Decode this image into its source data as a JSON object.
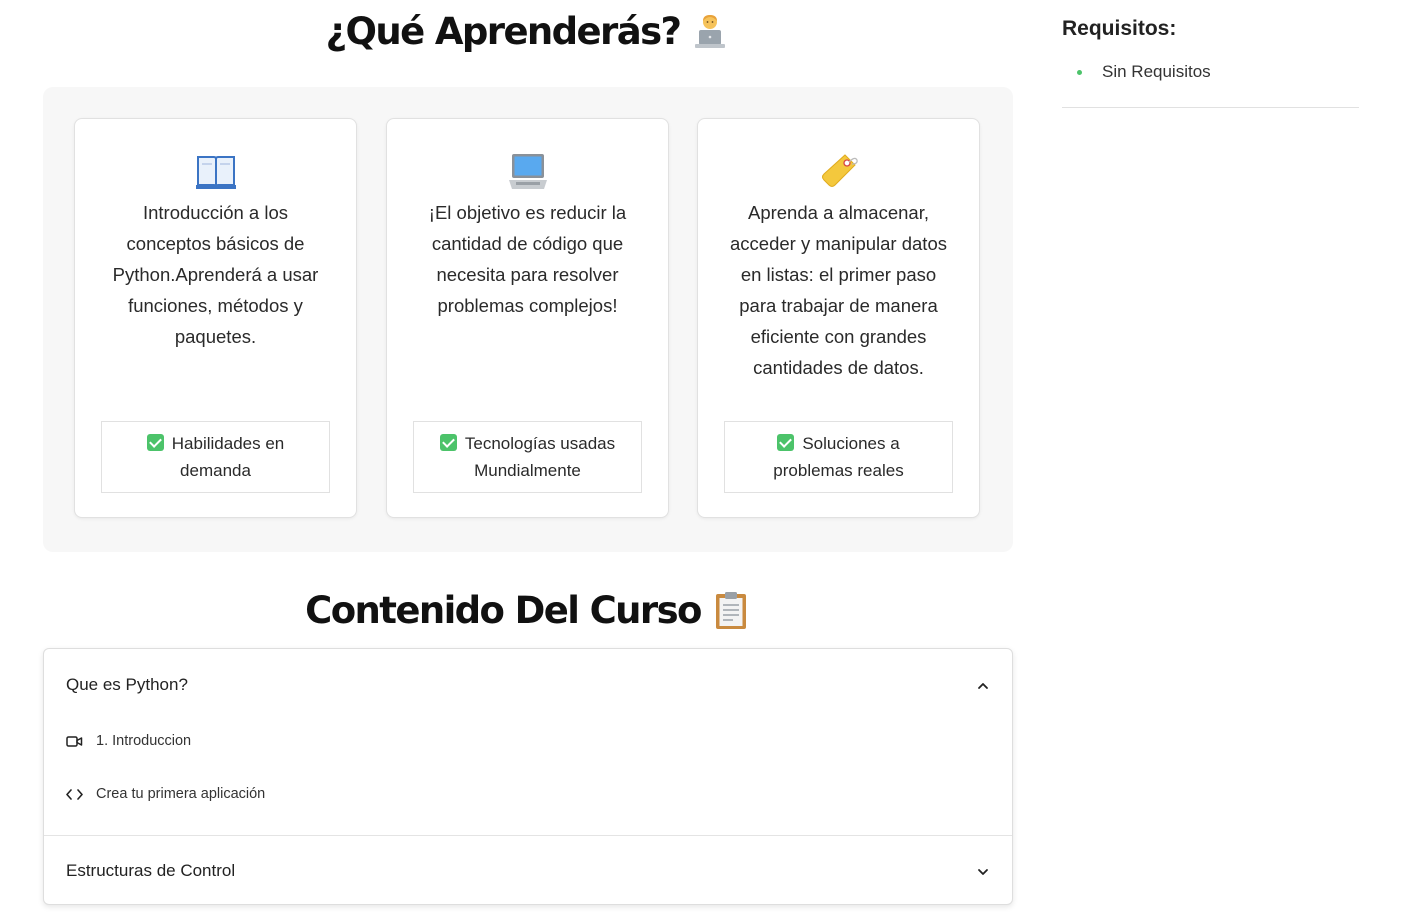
{
  "learn_section": {
    "title": "¿Qué Aprenderás?",
    "title_emoji": "technologist",
    "cards": [
      {
        "icon": "open-book-icon",
        "description": "Introducción a los conceptos básicos de Python.Aprenderá a usar funciones, métodos y paquetes.",
        "feature": "Habilidades en demanda"
      },
      {
        "icon": "laptop-icon",
        "description": "¡El objetivo es reducir la cantidad de código que necesita para resolver problemas complejos!",
        "feature": "Tecnologías usadas Mundialmente"
      },
      {
        "icon": "label-tag-icon",
        "description": "Aprenda a almacenar, acceder y manipular datos en listas: el primer paso para trabajar de manera eficiente con grandes cantidades de datos.",
        "feature": "Soluciones a problemas reales"
      }
    ]
  },
  "content_section": {
    "title": "Contenido Del Curso",
    "title_emoji": "clipboard",
    "modules": [
      {
        "title": "Que es Python?",
        "expanded": true,
        "lessons": [
          {
            "icon": "video-icon",
            "label": "1. Introduccion"
          },
          {
            "icon": "code-icon",
            "label": "Crea tu primera aplicación"
          }
        ]
      },
      {
        "title": "Estructuras de Control",
        "expanded": false
      }
    ]
  },
  "sidebar": {
    "title": "Requisitos:",
    "items": [
      "Sin Requisitos"
    ]
  },
  "colors": {
    "accent_green": "#4cc36a",
    "panel_bg": "#f7f7f7"
  }
}
